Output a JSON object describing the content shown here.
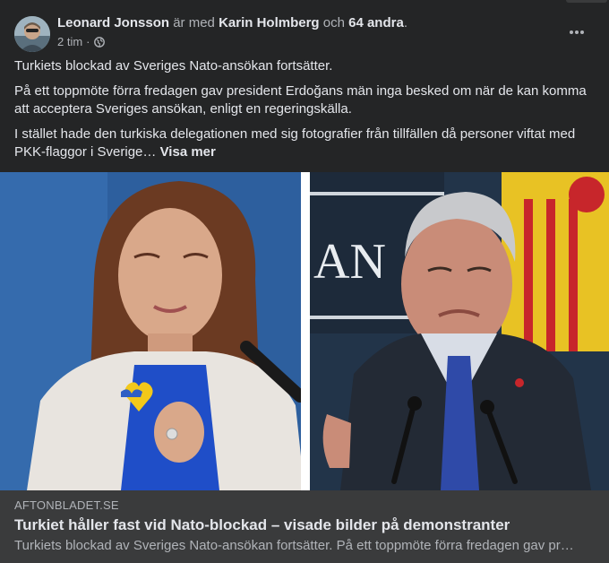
{
  "post": {
    "author": "Leonard Jonsson",
    "with_text": "är med",
    "tagged": "Karin Holmberg",
    "and_text": "och",
    "others": "64 andra",
    "period": ".",
    "time": "2 tim",
    "dot": "·",
    "audience_icon": "globe-icon",
    "paragraphs": [
      "Turkiets blockad av Sveriges Nato-ansökan fortsätter.",
      "På ett toppmöte förra fredagen gav president Erdoğans män inga besked om när de kan komma att acceptera Sveriges ansökan, enligt en regeringskälla.",
      "I stället hade den turkiska delegationen med sig fotografier från tillfällen då personer viftat med PKK-flaggor i Sverige…"
    ],
    "see_more": "Visa mer"
  },
  "photo": {
    "banner_text": "AN"
  },
  "link_preview": {
    "domain": "AFTONBLADET.SE",
    "title": "Turkiet håller fast vid Nato-blockad – visade bilder på demonstranter",
    "description": "Turkiets blockad av Sveriges Nato-ansökan fortsätter. På ett toppmöte förra fredagen gav pre…"
  },
  "colors": {
    "background": "#242526",
    "text": "#e4e6eb",
    "secondary": "#b0b3b8",
    "link_bg": "#3a3b3c"
  }
}
